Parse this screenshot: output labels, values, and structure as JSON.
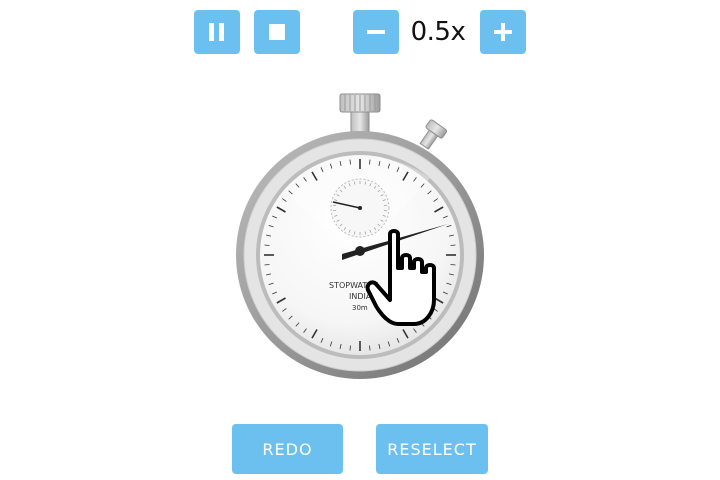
{
  "toolbar": {
    "pause_icon": "pause-icon",
    "stop_icon": "stop-icon",
    "minus_icon": "minus-icon",
    "plus_icon": "plus-icon",
    "speed": "0.5x"
  },
  "stopwatch": {
    "brand": "STOPWATCH",
    "country": "INDIA",
    "capacity": "30m"
  },
  "actions": {
    "redo": "REDO",
    "reselect": "RESELECT"
  },
  "cursor": {
    "icon": "hand-pointer-icon"
  },
  "colors": {
    "accent": "#6cc0f0",
    "button_text": "#ffffff"
  }
}
